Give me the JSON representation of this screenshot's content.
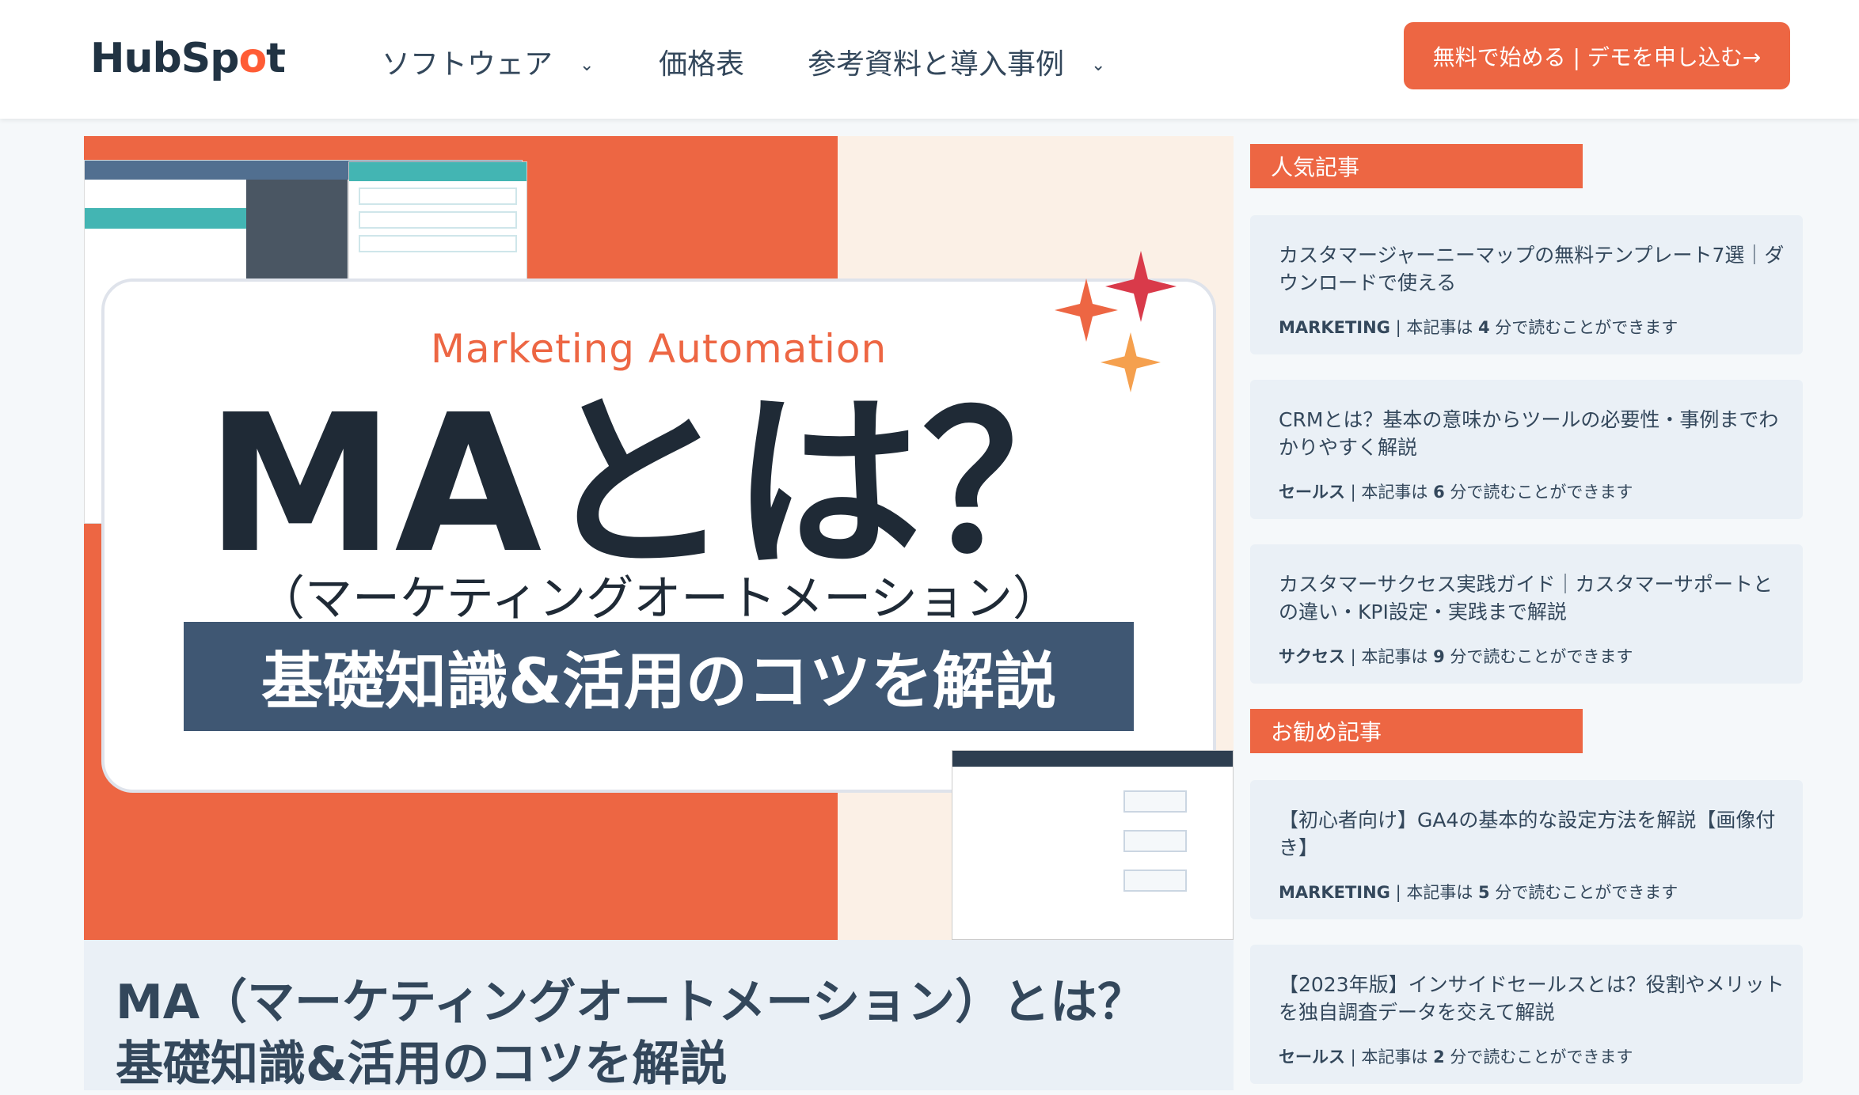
{
  "header": {
    "logo_text_a": "HubSp",
    "logo_text_b": "o",
    "logo_text_c": "t",
    "nav": [
      {
        "label": "ソフトウェア",
        "has_dropdown": true
      },
      {
        "label": "価格表",
        "has_dropdown": false
      },
      {
        "label": "参考資料と導入事例",
        "has_dropdown": true
      }
    ],
    "cta_label": "無料で始める | デモを申し込む→"
  },
  "hero": {
    "subtitle": "Marketing Automation",
    "title": "MAとは？",
    "kana": "（マーケティングオートメーション）",
    "banner": "基礎知識&活用のコツを解説"
  },
  "article": {
    "title": "MA（マーケティングオートメーション）とは？基礎知識&活用のコツを解説"
  },
  "sidebar": {
    "popular_heading": "人気記事",
    "recommended_heading": "お勧め記事",
    "popular": [
      {
        "title": "カスタマージャーニーマップの無料テンプレート7選｜ダウンロードで使える",
        "category": "MARKETING",
        "meta_prefix": " | 本記事は ",
        "minutes": "4",
        "meta_suffix": " 分で読むことができます"
      },
      {
        "title": "CRMとは？基本の意味からツールの必要性・事例までわかりやすく解説",
        "category": "セールス",
        "meta_prefix": " | 本記事は ",
        "minutes": "6",
        "meta_suffix": " 分で読むことができます"
      },
      {
        "title": "カスタマーサクセス実践ガイド｜カスタマーサポートとの違い・KPI設定・実践まで解説",
        "category": "サクセス",
        "meta_prefix": " | 本記事は ",
        "minutes": "9",
        "meta_suffix": " 分で読むことができます"
      }
    ],
    "recommended": [
      {
        "title": "【初心者向け】GA4の基本的な設定方法を解説【画像付き】",
        "category": "MARKETING",
        "meta_prefix": " | 本記事は ",
        "minutes": "5",
        "meta_suffix": " 分で読むことができます"
      },
      {
        "title": "【2023年版】インサイドセールスとは？役割やメリットを独自調査データを交えて解説",
        "category": "セールス",
        "meta_prefix": " | 本記事は ",
        "minutes": "2",
        "meta_suffix": " 分で読むことができます"
      }
    ]
  },
  "colors": {
    "accent": "#ed6643",
    "text": "#33475b",
    "card_bg": "#eaf0f6",
    "banner": "#3f5773"
  }
}
